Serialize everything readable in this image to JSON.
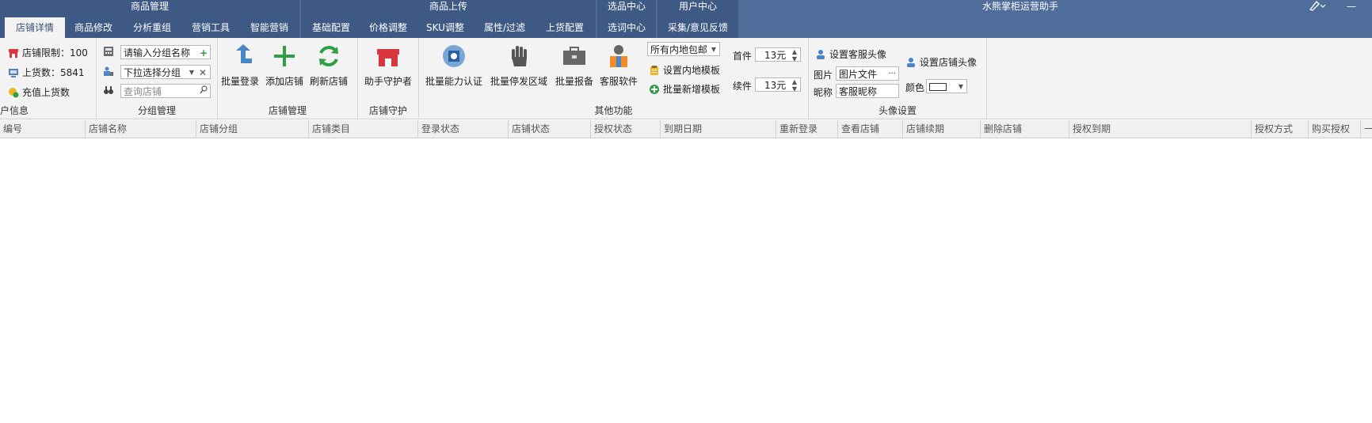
{
  "titlebar": {
    "groups": [
      {
        "title": "商品管理",
        "tabs": [
          "店铺详情",
          "商品修改",
          "分析重组",
          "营销工具",
          "智能营销"
        ]
      },
      {
        "title": "商品上传",
        "tabs": [
          "基础配置",
          "价格调整",
          "SKU调整",
          "属性/过滤",
          "上货配置"
        ]
      },
      {
        "title": "选品中心",
        "tabs": [
          "选词中心"
        ]
      },
      {
        "title": "用户中心",
        "tabs": [
          "采集/意见反馈"
        ]
      }
    ],
    "app_title": "水熊掌柜运营助手",
    "minimize": "—"
  },
  "shop_info": {
    "limit_label": "店铺限制：100",
    "stock_label": "上货数：5841",
    "recharge_label": "充值上货数",
    "group_label": "户信息"
  },
  "group_mgmt": {
    "name_placeholder": "请输入分组名称",
    "dropdown_value": "下拉选择分组",
    "search_placeholder": "查询店铺",
    "group_label": "分组管理"
  },
  "shop_mgmt": {
    "batch_login": "批量登录",
    "add_shop": "添加店铺",
    "refresh_shop": "刷新店铺",
    "group_label": "店铺管理"
  },
  "shop_guard": {
    "assistant_guard": "助手守护者",
    "group_label": "店铺守护"
  },
  "other_funcs": {
    "batch_cert": "批量能力认证",
    "batch_stop": "批量停发区域",
    "batch_report": "批量报备",
    "cs_software": "客服软件",
    "shipping_select": "所有内地包邮",
    "set_template": "设置内地模板",
    "batch_add_template": "批量新增模板",
    "first_label": "首件",
    "first_value": "13元",
    "renew_label": "续件",
    "renew_value": "13元",
    "group_label": "其他功能"
  },
  "avatar_settings": {
    "set_cs_avatar": "设置客服头像",
    "set_shop_avatar": "设置店铺头像",
    "image_label": "图片",
    "image_value": "图片文件",
    "image_more": "···",
    "nickname_label": "昵称",
    "nickname_value": "客服昵称",
    "color_label": "颜色",
    "group_label": "头像设置"
  },
  "table": {
    "columns": [
      "编号",
      "店铺名称",
      "店铺分组",
      "店铺类目",
      "登录状态",
      "店铺状态",
      "授权状态",
      "到期日期",
      "重新登录",
      "查看店铺",
      "店铺续期",
      "删除店铺",
      "授权到期",
      "授权方式",
      "购买授权",
      "一"
    ]
  },
  "colors": {
    "titlebar": "#4e6d9a",
    "ribbon": "#f3f3f3",
    "accent_green": "#2f9e44",
    "accent_blue": "#4a86c5"
  }
}
